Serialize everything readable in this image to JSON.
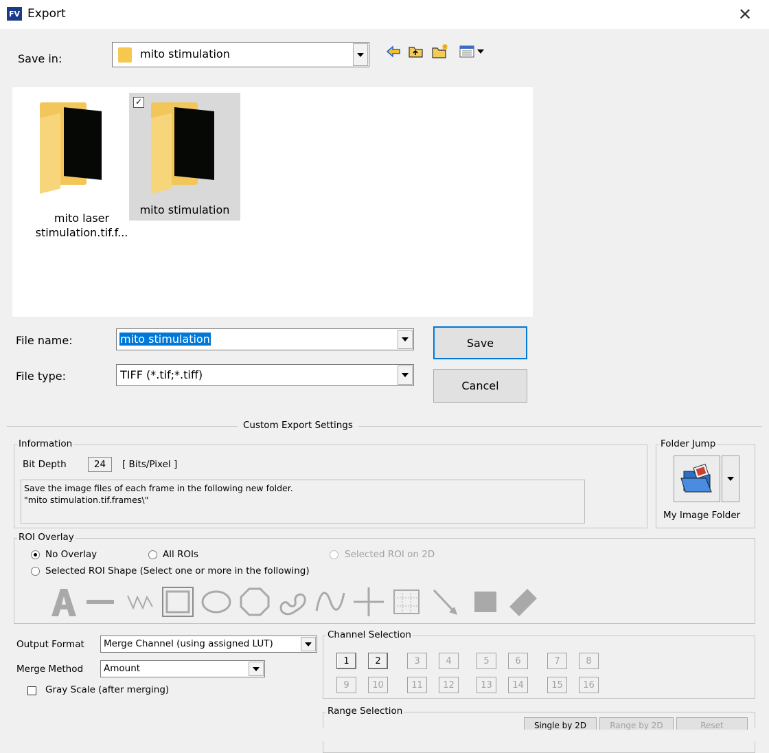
{
  "window": {
    "title": "Export",
    "app_badge": "FV",
    "close_glyph": "✕"
  },
  "toolbar": {
    "save_in_label": "Save in:",
    "save_in_value": "mito stimulation",
    "icons": [
      "back-arrow-icon",
      "up-folder-icon",
      "new-folder-icon",
      "view-menu-icon"
    ]
  },
  "files": [
    {
      "name_line1": "mito laser",
      "name_line2": "stimulation.tif.f...",
      "selected": false
    },
    {
      "name_line1": "mito stimulation",
      "name_line2": "",
      "selected": true,
      "check_glyph": "✓"
    }
  ],
  "file_name": {
    "label": "File name:",
    "value": "mito stimulation"
  },
  "file_type": {
    "label": "File type:",
    "value": "TIFF (*.tif;*.tiff)"
  },
  "buttons": {
    "save": "Save",
    "cancel": "Cancel"
  },
  "custom": {
    "title": "Custom Export Settings",
    "information": {
      "title": "Information",
      "bit_depth_label": "Bit Depth",
      "bit_depth_value": "24",
      "bit_depth_unit": "[ Bits/Pixel ]",
      "message_line1": "Save the image files of each frame in the following new folder.",
      "message_line2": "\"mito stimulation.tif.frames\\\""
    },
    "folder_jump": {
      "title": "Folder Jump",
      "label": "My Image Folder"
    },
    "roi_overlay": {
      "title": "ROI Overlay",
      "no_overlay": "No Overlay",
      "all_rois": "All ROIs",
      "selected_roi_2d": "Selected ROI on 2D",
      "selected_roi_shape": "Selected ROI Shape (Select one or more in the following)",
      "shapes": [
        "text-a-icon",
        "line-icon",
        "polyline-icon",
        "rectangle-icon",
        "ellipse-icon",
        "polygon-icon",
        "freehand-icon",
        "curve-icon",
        "cross-icon",
        "grid-icon",
        "arrow-icon",
        "filled-rect-icon",
        "eraser-icon"
      ]
    },
    "output_format": {
      "label": "Output Format",
      "value": "Merge Channel (using assigned LUT)"
    },
    "merge_method": {
      "label": "Merge Method",
      "value": "Amount"
    },
    "gray_scale": {
      "label": "Gray Scale (after merging)",
      "checked": false
    },
    "channel_selection": {
      "title": "Channel Selection",
      "row1": [
        "1",
        "2",
        "3",
        "4",
        "5",
        "6",
        "7",
        "8"
      ],
      "row2": [
        "9",
        "10",
        "11",
        "12",
        "13",
        "14",
        "15",
        "16"
      ],
      "active": [
        "1",
        "2"
      ]
    },
    "range_selection": {
      "title": "Range Selection",
      "buttons": [
        "Single by 2D",
        "Range by 2D",
        "Reset"
      ]
    }
  }
}
